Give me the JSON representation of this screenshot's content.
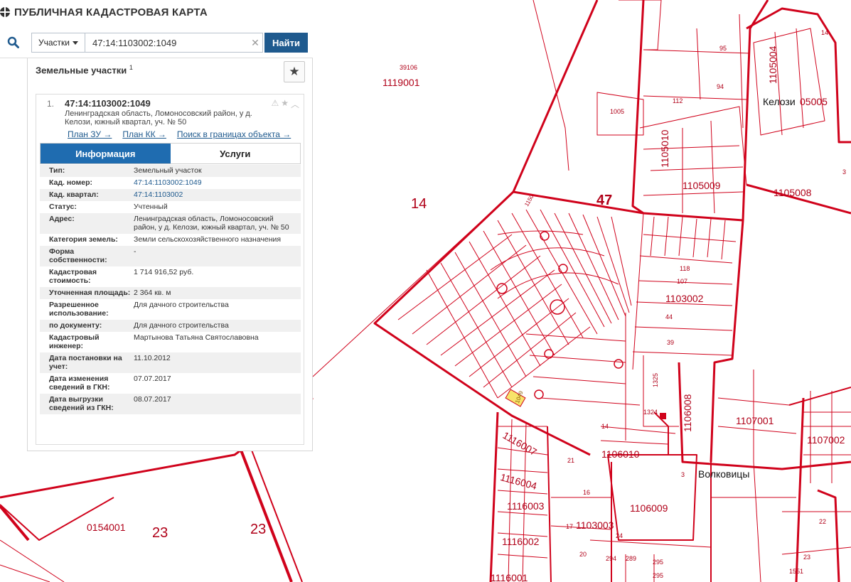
{
  "app": {
    "title": "ПУБЛИЧНАЯ КАДАСТРОВАЯ КАРТА"
  },
  "search": {
    "type_label": "Участки",
    "query": "47:14:1103002:1049",
    "find_label": "Найти"
  },
  "panel": {
    "heading": "Земельные участки",
    "heading_count": "1"
  },
  "result": {
    "index": "1.",
    "cad_number": "47:14:1103002:1049",
    "address": "Ленинградская область, Ломоносовский район, у д. Келози, южный квартал, уч. № 50",
    "links": {
      "plan_zu": "План ЗУ →",
      "plan_kk": "План КК →",
      "search_bounds": "Поиск в границах объекта →"
    },
    "tabs": {
      "info": "Информация",
      "services": "Услуги"
    }
  },
  "attributes": [
    {
      "key": "Тип:",
      "value": "Земельный участок",
      "link": false
    },
    {
      "key": "Кад. номер:",
      "value": "47:14:1103002:1049",
      "link": true
    },
    {
      "key": "Кад. квартал:",
      "value": "47:14:1103002",
      "link": true
    },
    {
      "key": "Статус:",
      "value": "Учтенный",
      "link": false
    },
    {
      "key": "Адрес:",
      "value": "Ленинградская область, Ломоносовский район, у д. Келози, южный квартал, уч. № 50",
      "link": false
    },
    {
      "key": "Категория земель:",
      "value": "Земли сельскохозяйственного назначения",
      "link": false
    },
    {
      "key": "Форма собственности:",
      "value": "-",
      "link": false
    },
    {
      "key": "Кадастровая стоимость:",
      "value": "1 714 916,52 руб.",
      "link": false
    },
    {
      "key": "Уточненная площадь:",
      "value": "2 364 кв. м",
      "link": false
    },
    {
      "key": "Разрешенное использование:",
      "value": "Для дачного строительства",
      "link": false
    },
    {
      "key": "по документу:",
      "value": "Для дачного строительства",
      "link": false
    },
    {
      "key": "Кадастровый инженер:",
      "value": "Мартынова Татьяна Святославовна",
      "link": false
    },
    {
      "key": "Дата постановки на учет:",
      "value": "11.10.2012",
      "link": false
    },
    {
      "key": "Дата изменения сведений в ГКН:",
      "value": "07.07.2017",
      "link": false
    },
    {
      "key": "Дата выгрузки сведений из ГКН:",
      "value": "08.07.2017",
      "link": false
    }
  ],
  "map": {
    "labels": {
      "region47": "47",
      "district14": "14",
      "district23a": "23",
      "district23b": "23",
      "q1119001": "1119001",
      "n39106": "39106",
      "q0154001": "0154001",
      "q1103002": "1103002",
      "q1105009": "1105009",
      "q1105008": "1105008",
      "q1105010": "1105010",
      "q1105004": "1105004",
      "q1107001": "1107001",
      "q1107002": "1107002",
      "q1106008": "1106008",
      "q1106010": "1106010",
      "q1106009": "1106009",
      "q1103003": "1103003",
      "q1116003": "1116003",
      "q1116002": "1116002",
      "q1116004": "1116004",
      "q1116007": "1116007",
      "q1116001": "1116001",
      "kelozi": "Келози",
      "q05005": "05005",
      "volkovitsy": "Волковицы",
      "p95": "95",
      "p94": "94",
      "p112": "112",
      "p1005": "1005",
      "p118": "118",
      "p107": "107",
      "p44": "44",
      "p39": "39",
      "p1325": "1325",
      "p1324": "1324",
      "p21": "21",
      "p16": "16",
      "p24": "24",
      "p17": "17",
      "p20": "20",
      "p294": "294",
      "p289": "289",
      "p295a": "295",
      "p295b": "295",
      "p1551": "1551",
      "p23": "23",
      "p22": "22",
      "p3a": "3",
      "p3b": "3",
      "p14a": "14",
      "p14b": "14",
      "p1150": "1150",
      "p1049": "1049"
    },
    "highlight_color": "#f7e36a",
    "line_color": "#d0021b"
  }
}
